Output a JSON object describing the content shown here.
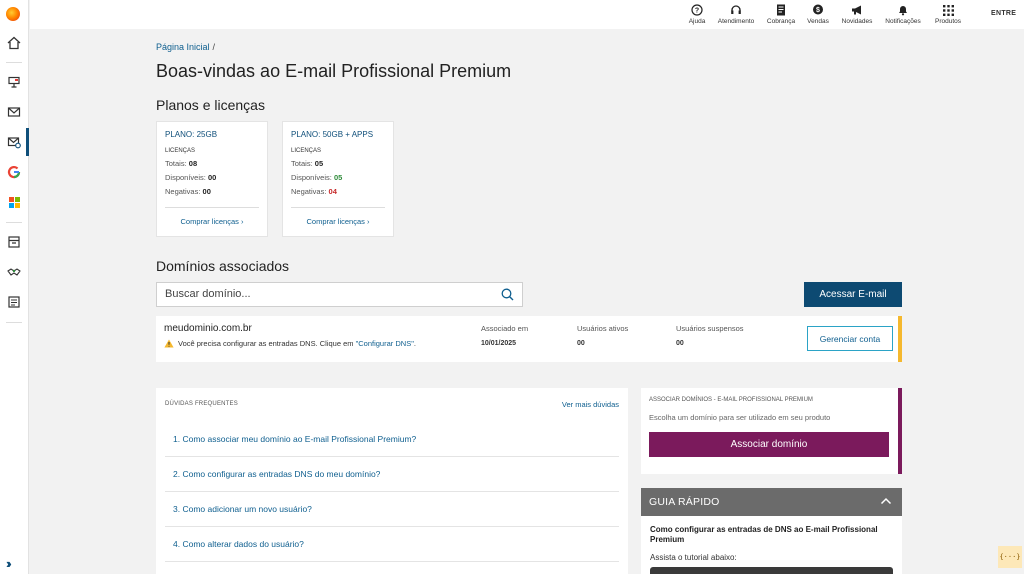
{
  "topbar": {
    "items": [
      {
        "label": "Ajuda",
        "icon": "help-circle-icon"
      },
      {
        "label": "Atendimento",
        "icon": "headset-icon"
      },
      {
        "label": "Cobrança",
        "icon": "document-icon"
      },
      {
        "label": "Vendas",
        "icon": "dollar-bubble-icon"
      },
      {
        "label": "Novidades",
        "icon": "megaphone-icon"
      },
      {
        "label": "Notificações",
        "icon": "bell-icon"
      },
      {
        "label": "Produtos",
        "icon": "grid-icon"
      }
    ],
    "login": "ENTRE"
  },
  "breadcrumb": {
    "home": "Página Inicial",
    "separator": "/"
  },
  "page_title": "Boas-vindas ao E-mail Profissional Premium",
  "plans": {
    "title": "Planos e licenças",
    "cards": [
      {
        "name": "PLANO: 25GB",
        "licenses_label": "LICENÇAS",
        "total_label": "Totais:",
        "total": "08",
        "available_label": "Disponíveis:",
        "available": "00",
        "negative_label": "Negativas:",
        "negative": "00",
        "buy": "Comprar licenças"
      },
      {
        "name": "PLANO: 50GB + APPS",
        "licenses_label": "LICENÇAS",
        "total_label": "Totais:",
        "total": "05",
        "available_label": "Disponíveis:",
        "available": "05",
        "negative_label": "Negativas:",
        "negative": "04",
        "buy": "Comprar licenças"
      }
    ]
  },
  "domains": {
    "title": "Domínios associados",
    "search_placeholder": "Buscar domínio...",
    "access_button": "Acessar E-mail",
    "rows": [
      {
        "name": "meudominio.com.br",
        "warning_text": "Você precisa configurar as entradas DNS. Clique em ",
        "warning_link": "\"Configurar DNS\"",
        "warning_end": ".",
        "associated_label": "Associado em",
        "associated": "10/01/2025",
        "active_label": "Usuários ativos",
        "active": "00",
        "suspended_label": "Usuários suspensos",
        "suspended": "00",
        "manage_button": "Gerenciar conta"
      }
    ]
  },
  "faq": {
    "title": "DÚVIDAS FREQUENTES",
    "more": "Ver mais dúvidas",
    "items": [
      "1. Como associar meu domínio ao E-mail Profissional Premium?",
      "2. Como configurar as entradas DNS do meu domínio?",
      "3. Como adicionar um novo usuário?",
      "4. Como alterar dados do usuário?"
    ]
  },
  "associate": {
    "title": "ASSOCIAR DOMÍNIOS - E-MAIL PROFISSIONAL PREMIUM",
    "subtitle": "Escolha um domínio para ser utilizado em seu produto",
    "button": "Associar domínio"
  },
  "guide": {
    "title": "GUIA RÁPIDO",
    "question": "Como configurar as entradas de DNS ao E-mail Profissional Premium",
    "subtitle": "Assista o tutorial abaixo:"
  },
  "devtool": "{···}",
  "colors": {
    "primary": "#0d4a72",
    "link": "#0f5f8f",
    "warning": "#f5b82e",
    "accent": "#7b1a5c",
    "guide_header": "#6b6b6b"
  }
}
